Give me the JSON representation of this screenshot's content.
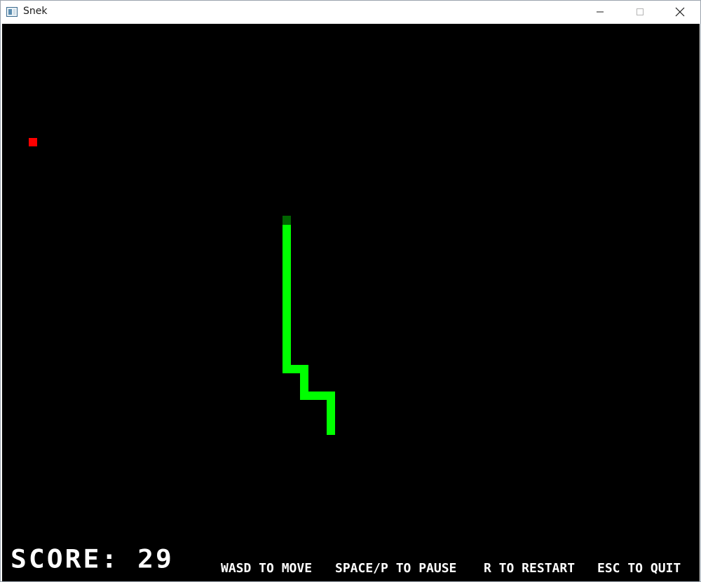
{
  "window": {
    "title": "Snek",
    "controls": [
      "minimize",
      "maximize",
      "close"
    ]
  },
  "game": {
    "score_text": "SCORE: 29",
    "score": 29,
    "hints": [
      "WASD TO MOVE",
      "SPACE/P TO PAUSE",
      "R TO RESTART",
      "ESC TO QUIT"
    ],
    "colors": {
      "background": "#000000",
      "snake_body": "#00ff00",
      "snake_head": "#006400",
      "food": "#ff0000",
      "text": "#ffffff"
    }
  }
}
